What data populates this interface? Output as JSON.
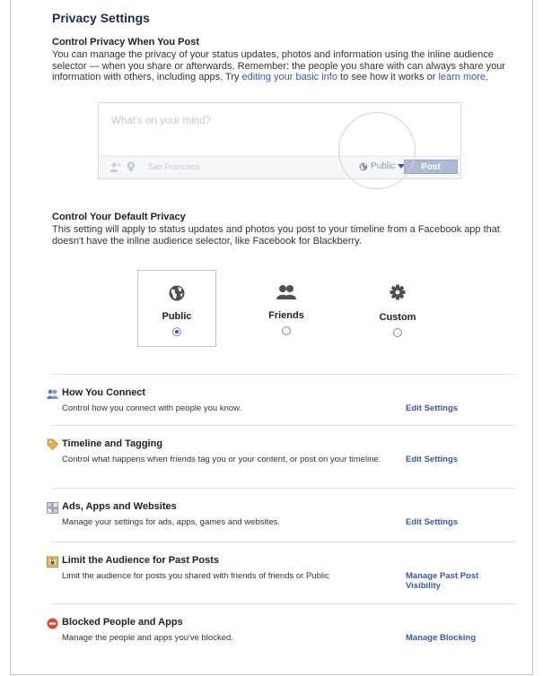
{
  "page_title": "Privacy Settings",
  "control_post": {
    "title": "Control Privacy When You Post",
    "text_before": "You can manage the privacy of your status updates, photos and information using the inline audience selector — when you share or afterwards. Remember: the people you share with can always share your information with others, including apps. Try ",
    "link_basic_info": "editing your basic info",
    "text_mid": " to see how it works or ",
    "link_learn_more": "learn more",
    "text_after": "."
  },
  "composer": {
    "placeholder": "What's on your mind?",
    "location": "San Francisco",
    "audience": "Public",
    "post_label": "Post"
  },
  "default_privacy": {
    "title": "Control Your Default Privacy",
    "text": "This setting will apply to status updates and photos you post to your timeline from a Facebook app that doesn't have the inline audience selector, like Facebook for Blackberry.",
    "options": [
      {
        "label": "Public",
        "icon": "globe-icon",
        "selected": true
      },
      {
        "label": "Friends",
        "icon": "friends-icon",
        "selected": false
      },
      {
        "label": "Custom",
        "icon": "gear-icon",
        "selected": false
      }
    ]
  },
  "settings": [
    {
      "title": "How You Connect",
      "icon": "people-icon",
      "desc": "Control how you connect with people you know.",
      "action": "Edit Settings"
    },
    {
      "title": "Timeline and Tagging",
      "icon": "tag-icon",
      "desc": "Control what happens when friends tag you or your content, or post on your timeline.",
      "action": "Edit Settings"
    },
    {
      "title": "Ads, Apps and Websites",
      "icon": "apps-icon",
      "desc": "Manage your settings for ads, apps, games and websites.",
      "action": "Edit Settings"
    },
    {
      "title": "Limit the Audience for Past Posts",
      "icon": "lock-icon",
      "desc": "Limit the audience for posts you shared with friends of friends or Public",
      "action": "Manage Past Post Visibility"
    },
    {
      "title": "Blocked People and Apps",
      "icon": "block-icon",
      "desc": "Manage the people and apps you've blocked.",
      "action": "Manage Blocking"
    }
  ],
  "colors": {
    "link": "#3b5998",
    "heading": "#1c2a47",
    "block_red": "#d9473a"
  }
}
